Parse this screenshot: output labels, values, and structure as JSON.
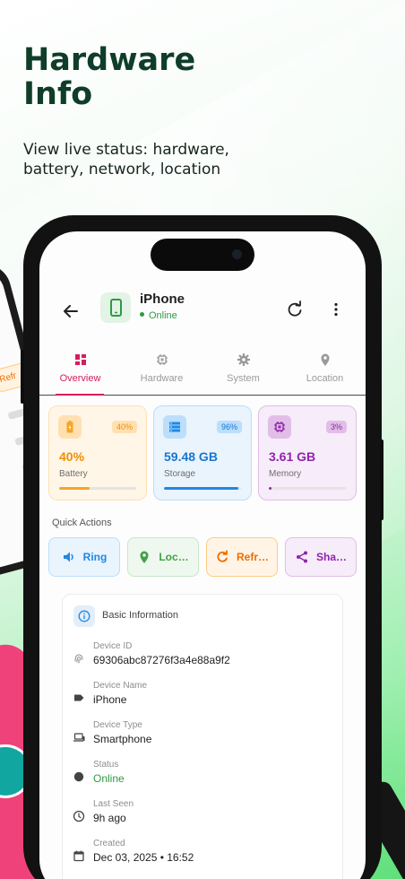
{
  "hero": {
    "title_line1": "Hardware",
    "title_line2": "Info",
    "subtitle": "View live status: hardware, battery, network, location"
  },
  "app_bar": {
    "device_name": "iPhone",
    "status": "Online"
  },
  "tabs": [
    {
      "label": "Overview",
      "icon": "dashboard-icon",
      "active": true
    },
    {
      "label": "Hardware",
      "icon": "chip-icon",
      "active": false
    },
    {
      "label": "System",
      "icon": "gear-icon",
      "active": false
    },
    {
      "label": "Location",
      "icon": "location-pin-icon",
      "active": false
    }
  ],
  "stats": [
    {
      "value": "40%",
      "label": "Battery",
      "badge": "40%",
      "level": 0.4,
      "icon": "battery-icon",
      "accent": "#f5a623",
      "bg": "#fff6e8",
      "border": "#ffe0b2",
      "text": "#ef8f00"
    },
    {
      "value": "59.48 GB",
      "label": "Storage",
      "badge": "96%",
      "level": 0.96,
      "icon": "storage-icon",
      "accent": "#1e88e5",
      "bg": "#eaf4fd",
      "border": "#bbdefb",
      "text": "#1976d2"
    },
    {
      "value": "3.61 GB",
      "label": "Memory",
      "badge": "3%",
      "level": 0.03,
      "icon": "memory-chip-icon",
      "accent": "#8e24aa",
      "bg": "#f7ecf9",
      "border": "#e1bee7",
      "text": "#8e24aa"
    }
  ],
  "quick_actions": {
    "title": "Quick Actions",
    "items": [
      {
        "label": "Ring",
        "icon": "speaker-icon",
        "color": "#1e88e5",
        "bg": "#eaf4fd",
        "border": "#bbdefb"
      },
      {
        "label": "Loc…",
        "icon": "location-pin-icon",
        "color": "#43a047",
        "bg": "#eef8ef",
        "border": "#c8e6c9"
      },
      {
        "label": "Refr…",
        "icon": "refresh-icon",
        "color": "#ef6c00",
        "bg": "#fff4e6",
        "border": "#ffcc80"
      },
      {
        "label": "Sha…",
        "icon": "share-icon",
        "color": "#8e24aa",
        "bg": "#f7ecf9",
        "border": "#e1bee7"
      }
    ]
  },
  "basic_info": {
    "title": "Basic Information",
    "rows": [
      {
        "label": "Device ID",
        "value": "69306abc87276f3a4e88a9f2",
        "icon": "fingerprint-icon"
      },
      {
        "label": "Device Name",
        "value": "iPhone",
        "icon": "tag-icon"
      },
      {
        "label": "Device Type",
        "value": "Smartphone",
        "icon": "laptop-icon"
      },
      {
        "label": "Status",
        "value": "Online",
        "icon": "status-dot-icon"
      },
      {
        "label": "Last Seen",
        "value": "9h ago",
        "icon": "clock-icon"
      },
      {
        "label": "Created",
        "value": "Dec 03, 2025 • 16:52",
        "icon": "calendar-icon"
      }
    ]
  },
  "bg_devices": {
    "left_button_text": "Refr"
  }
}
